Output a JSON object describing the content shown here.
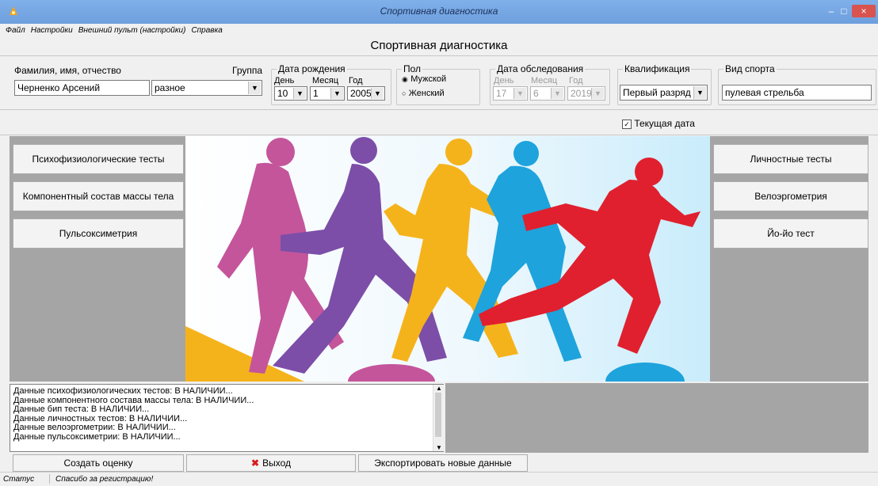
{
  "window": {
    "title": "Спортивная диагностика",
    "controls": [
      "–",
      "□",
      "×"
    ]
  },
  "menu": {
    "items": [
      "Файл",
      "Настройки",
      "Внешний пульт (настройки)",
      "Справка"
    ]
  },
  "header": {
    "title": "Спортивная диагностика"
  },
  "form": {
    "name_label": "Фамилия, имя, отчество",
    "name_value": "Черненко Арсений",
    "group_label": "Группа",
    "group_value": "разное",
    "birth": {
      "title": "Дата рождения",
      "day_label": "День",
      "day_value": "10",
      "month_label": "Месяц",
      "month_value": "1",
      "year_label": "Год",
      "year_value": "2005"
    },
    "sex": {
      "title": "Пол",
      "male": "Мужской",
      "female": "Женский",
      "selected": "male"
    },
    "exam": {
      "title": "Дата обследования",
      "day_label": "День",
      "day_value": "17",
      "month_label": "Месяц",
      "month_value": "6",
      "year_label": "Год",
      "year_value": "2019"
    },
    "qualification": {
      "title": "Квалификация",
      "value": "Первый разряд"
    },
    "sport": {
      "title": "Вид спорта",
      "value": "пулевая стрельба"
    },
    "current_date": {
      "label": "Текущая дата",
      "checked": true
    }
  },
  "left_buttons": [
    "Психофизиологические тесты",
    "Компонентный состав массы тела",
    "Пульсоксиметрия"
  ],
  "right_buttons": [
    "Личностные тесты",
    "Велоэргометрия",
    "Йо-йо тест"
  ],
  "log": {
    "lines": [
      "Данные психофизиологических тестов: В НАЛИЧИИ...",
      "Данные компонентного состава массы тела: В НАЛИЧИИ...",
      "Данные бип теста: В НАЛИЧИИ...",
      "Данные личностных тестов: В НАЛИЧИИ...",
      "Данные велоэргометрии: В НАЛИЧИИ...",
      "Данные пульсоксиметрии: В НАЛИЧИИ..."
    ]
  },
  "bottom_buttons": {
    "create": "Создать оценку",
    "exit": "Выход",
    "export": "Экспортировать новые данные"
  },
  "status": {
    "label": "Статус",
    "text": "Спасибо за регистрацию!"
  },
  "colors": {
    "runner_pink": "#c4559b",
    "runner_purple": "#7c4ea8",
    "runner_yellow": "#f5b31b",
    "runner_blue": "#1ea3dc",
    "runner_red": "#e0202e",
    "exit_icon": "#d81e1e"
  }
}
